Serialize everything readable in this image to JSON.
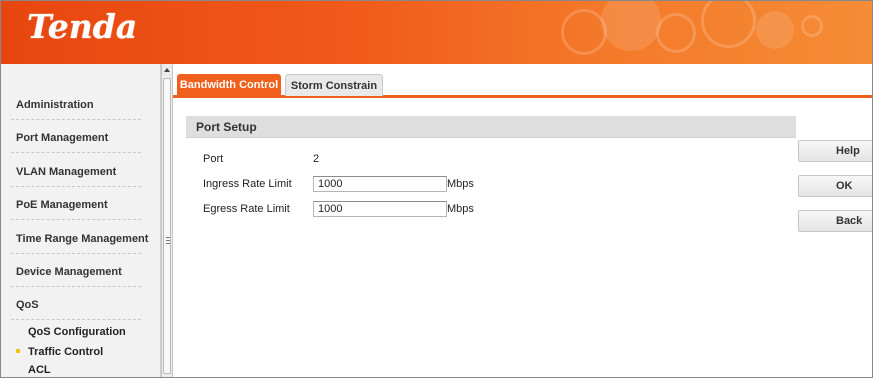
{
  "header": {
    "logo_text": "Tenda",
    "accent_color": "#f0601c"
  },
  "sidebar": {
    "items": [
      {
        "label": "Administration"
      },
      {
        "label": "Port Management"
      },
      {
        "label": "VLAN Management"
      },
      {
        "label": "PoE Management"
      },
      {
        "label": "Time Range Management"
      },
      {
        "label": "Device Management"
      },
      {
        "label": "QoS"
      }
    ],
    "subitems": [
      {
        "label": "QoS Configuration"
      },
      {
        "label": "Traffic Control",
        "selected": true
      },
      {
        "label": "ACL"
      }
    ]
  },
  "tabs": [
    {
      "label": "Bandwidth Control",
      "active": true
    },
    {
      "label": "Storm Constrain",
      "active": false
    }
  ],
  "port_setup": {
    "title": "Port Setup",
    "port_label": "Port",
    "port_value": "2",
    "ingress_label": "Ingress Rate Limit",
    "ingress_value": "1000",
    "egress_label": "Egress Rate Limit",
    "egress_value": "1000",
    "unit": "Mbps"
  },
  "buttons": {
    "help": "Help",
    "ok": "OK",
    "back": "Back"
  },
  "icons": {
    "scroll_up": "scroll-up-arrow-icon",
    "grip": "splitter-grip-icon",
    "bullet": "selected-bullet-icon"
  }
}
